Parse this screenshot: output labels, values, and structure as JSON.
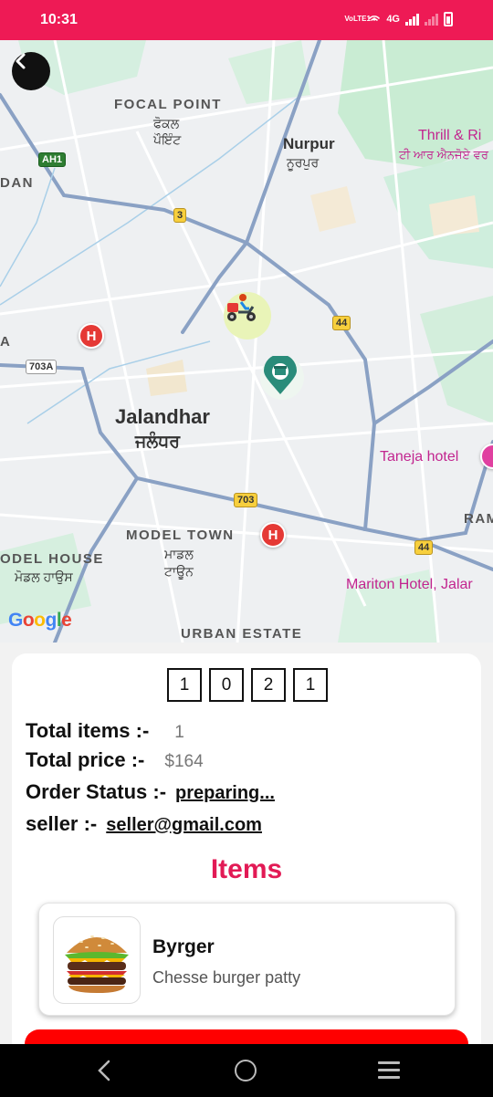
{
  "status_bar": {
    "time": "10:31",
    "network_label": "4G",
    "volte_label": "VoLTE1"
  },
  "map": {
    "labels": {
      "focal_point": "FOCAL POINT",
      "focal_point_local": "ਫੋਕਲ\nਪੌਇੰਟ",
      "nurpur": "Nurpur",
      "nurpur_local": "ਨੂਰਪੁਰ",
      "thrill": "Thrill & Ri",
      "thrill_local": "ਟੀ ਆਰ ਐਨਜੋਏ ਵਰ",
      "dan": "DAN",
      "jalandhar": "Jalandhar",
      "jalandhar_local": "ਜਲੰਧਰ",
      "taneja": "Taneja hotel",
      "model_town": "MODEL TOWN",
      "model_town_local": "ਮਾਡਲ\nਟਾਊਨ",
      "model_house": "ODEL HOUSE",
      "model_house_local": "ਮੋਡਲ ਹਾਉਸ",
      "ram": "RAM",
      "mariton": "Mariton Hotel, Jalar",
      "urban_estate": "URBAN ESTATE",
      "a": "A"
    },
    "shields": {
      "ah1": "AH1",
      "r3": "3",
      "r44a": "44",
      "r703a": "703A",
      "r703": "703",
      "r44b": "44"
    },
    "hospital_glyph": "H",
    "google_logo": [
      "G",
      "o",
      "o",
      "g",
      "l",
      "e"
    ],
    "google_colors": [
      "#4285F4",
      "#EA4335",
      "#FBBC05",
      "#4285F4",
      "#34A853",
      "#EA4335"
    ]
  },
  "order": {
    "otp_digits": [
      "1",
      "0",
      "2",
      "1"
    ],
    "total_items_label": "Total items :-",
    "total_items_value": "1",
    "total_price_label": "Total price :-",
    "total_price_value": "$164",
    "status_label": "Order Status :-",
    "status_value": "preparing...",
    "seller_label": "seller :-",
    "seller_value": "seller@gmail.com"
  },
  "items_section": {
    "title": "Items",
    "items": [
      {
        "name": "Byrger",
        "description": "Chesse burger patty",
        "icon": "burger-image"
      }
    ]
  },
  "colors": {
    "brand": "#ee1a55",
    "items_title": "#e21a55",
    "action_button": "#ff0000"
  }
}
